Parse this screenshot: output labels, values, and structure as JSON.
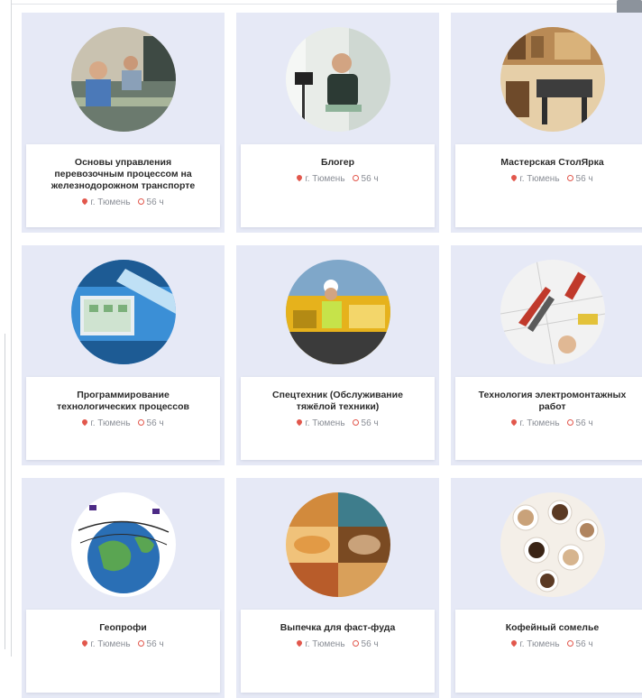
{
  "courses": [
    {
      "title": "Основы управления перевозочным процессом на железнодорожном транспорте",
      "city": "г. Тюмень",
      "hours": "56 ч",
      "image_icon": "railway-control-room-photo",
      "palette": [
        "#6b7a6e",
        "#c9c2b0",
        "#3e4a44"
      ]
    },
    {
      "title": "Блогер",
      "city": "г. Тюмень",
      "hours": "56 ч",
      "image_icon": "blogger-photo",
      "palette": [
        "#e8ece8",
        "#2c3a34",
        "#8fb39a"
      ]
    },
    {
      "title": "Мастерская СтолЯрка",
      "city": "г. Тюмень",
      "hours": "56 ч",
      "image_icon": "workshop-photo",
      "palette": [
        "#b98a55",
        "#6e4a2a",
        "#e6cfa8"
      ]
    },
    {
      "title": "Программирование технологических процессов",
      "city": "г. Тюмень",
      "hours": "56 ч",
      "image_icon": "process-programming-photo",
      "palette": [
        "#3b8fd6",
        "#bfe0f5",
        "#1d5b94"
      ]
    },
    {
      "title": "Спецтехник (Обслуживание тяжёлой техники)",
      "city": "г. Тюмень",
      "hours": "56 ч",
      "image_icon": "heavy-machinery-photo",
      "palette": [
        "#e6b21c",
        "#3b3b3b",
        "#f3d66a"
      ]
    },
    {
      "title": "Технология электромонтажных работ",
      "city": "г. Тюмень",
      "hours": "56 ч",
      "image_icon": "electrical-tools-photo",
      "palette": [
        "#f2f2f2",
        "#c0392b",
        "#5a5a5a"
      ]
    },
    {
      "title": "Геопрофи",
      "city": "г. Тюмень",
      "hours": "56 ч",
      "image_icon": "globe-logo",
      "palette": [
        "#2a6fb5",
        "#5aa552",
        "#ffffff"
      ]
    },
    {
      "title": "Выпечка для фаст-фуда",
      "city": "г. Тюмень",
      "hours": "56 ч",
      "image_icon": "fast-food-photo",
      "palette": [
        "#d28a3c",
        "#7a4a22",
        "#f0c27a"
      ]
    },
    {
      "title": "Кофейный сомелье",
      "city": "г. Тюмень",
      "hours": "56 ч",
      "image_icon": "coffee-cups-photo",
      "palette": [
        "#f4efe8",
        "#5b3a24",
        "#c9a27a"
      ]
    }
  ],
  "colors": {
    "card_background": "#e6e9f6",
    "accent": "#e2574c",
    "title_text": "#2b2b2b",
    "meta_text": "#8a8e96"
  }
}
